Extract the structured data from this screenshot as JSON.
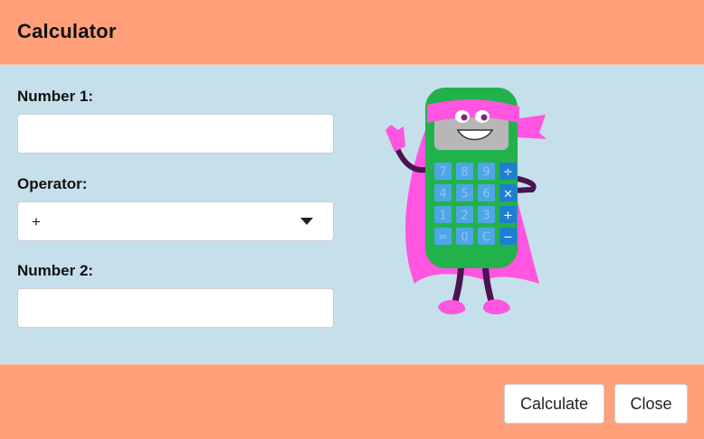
{
  "header": {
    "title": "Calculator"
  },
  "form": {
    "number1_label": "Number 1:",
    "number1_value": "",
    "operator_label": "Operator:",
    "operator_value": "+",
    "number2_label": "Number 2:",
    "number2_value": ""
  },
  "mascot": {
    "icon": "calculator-mascot-icon",
    "keys": [
      "7",
      "8",
      "9",
      "÷",
      "4",
      "5",
      "6",
      "×",
      "1",
      "2",
      "3",
      "+",
      "=",
      "0",
      "C",
      "−"
    ]
  },
  "footer": {
    "calculate_label": "Calculate",
    "close_label": "Close"
  },
  "colors": {
    "header_bg": "#ffa07a",
    "content_bg": "#c5e0ea",
    "mascot_body": "#22b24c",
    "mascot_cape": "#ff55e0",
    "mascot_keys": "#3b9be0"
  }
}
